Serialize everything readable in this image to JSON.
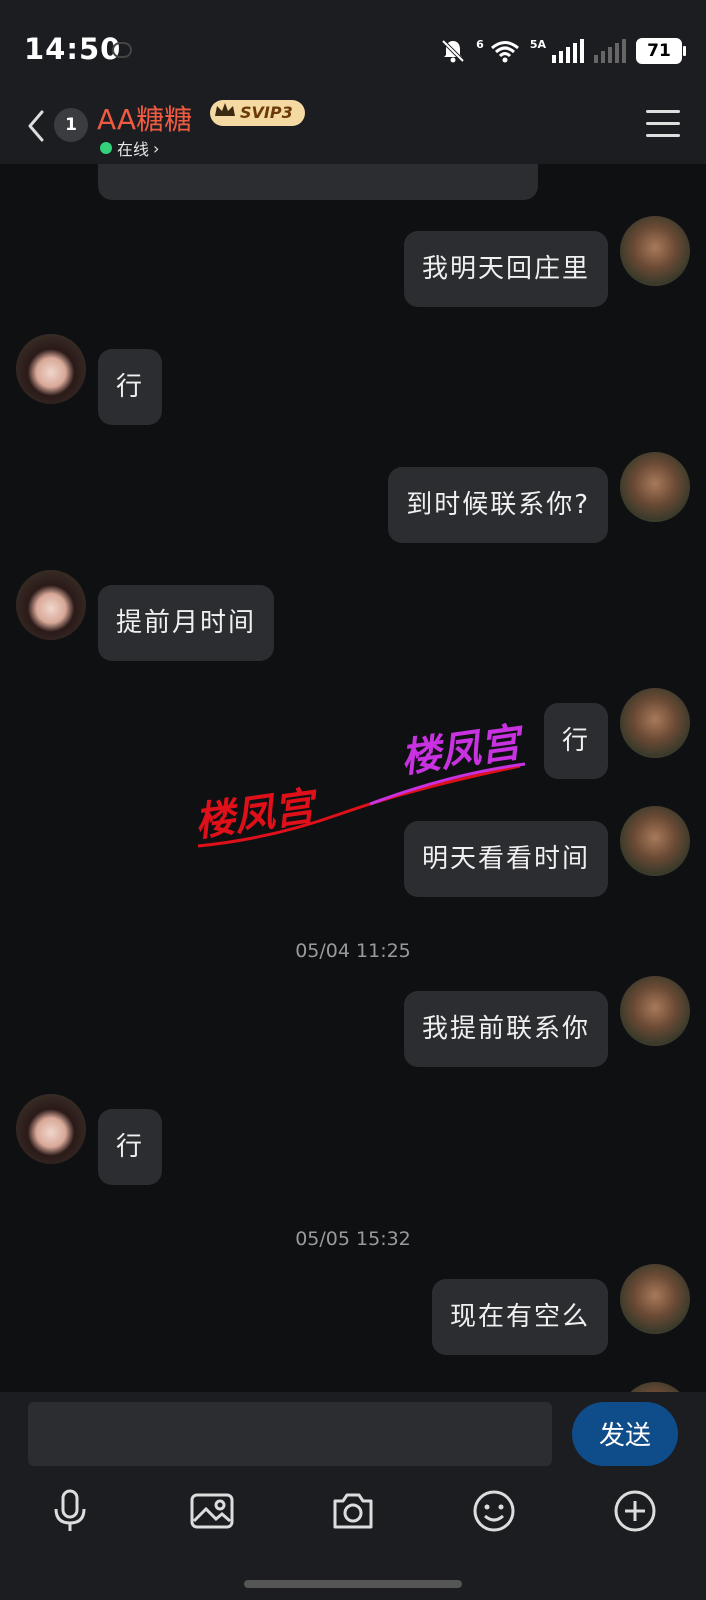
{
  "status_bar": {
    "time": "14:50",
    "network_label_1": "6",
    "network_label_2": "5A",
    "battery": "71"
  },
  "header": {
    "unread_count": "1",
    "title": "AA糖糖",
    "badge": "SVIP3",
    "online_status": "在线"
  },
  "messages": [
    {
      "side": "me",
      "text": "我明天回庄里"
    },
    {
      "side": "her",
      "text": "行"
    },
    {
      "side": "me",
      "text": "到时候联系你?"
    },
    {
      "side": "her",
      "text": "提前月时间"
    },
    {
      "side": "me",
      "text": "行"
    },
    {
      "side": "me",
      "text": "明天看看时间"
    },
    {
      "timestamp": "05/04 11:25"
    },
    {
      "side": "me",
      "text": "我提前联系你"
    },
    {
      "side": "her",
      "text": "行"
    },
    {
      "timestamp": "05/05 15:32"
    },
    {
      "side": "me",
      "text": "现在有空么"
    }
  ],
  "watermark": {
    "text_1": "楼凤宫",
    "text_2": "楼凤宫"
  },
  "input_bar": {
    "send_label": "发送",
    "tools": [
      "microphone-icon",
      "image-icon",
      "camera-icon",
      "emoji-icon",
      "add-icon"
    ]
  }
}
